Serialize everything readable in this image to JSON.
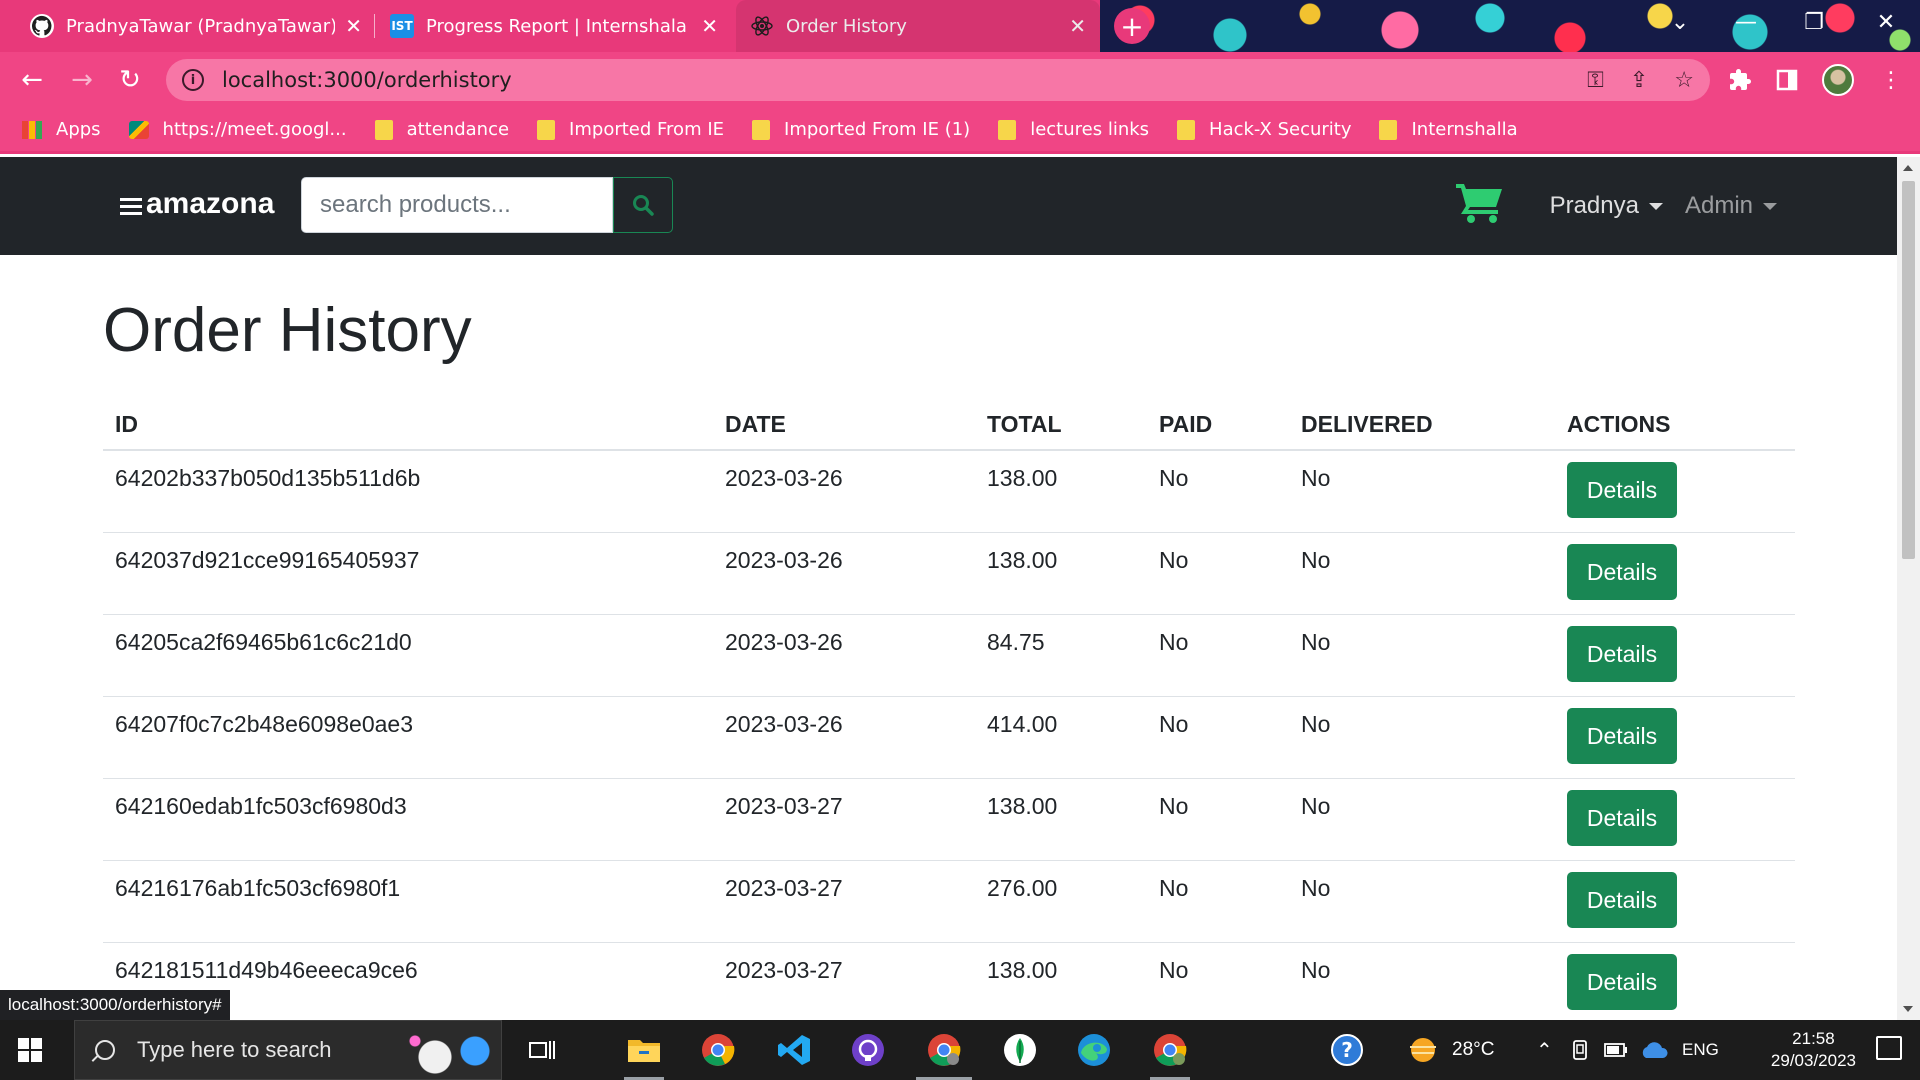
{
  "browser": {
    "tabs": [
      {
        "title": "PradnyaTawar (PradnyaTawar) / R",
        "favicon": "github-icon"
      },
      {
        "title": "Progress Report | Internshala Trai",
        "favicon": "internshala-icon",
        "favicon_text": "IST"
      },
      {
        "title": "Order History",
        "favicon": "react-icon",
        "active": true
      }
    ],
    "address": "localhost:3000/orderhistory",
    "bookmarks": [
      {
        "label": "Apps",
        "icon": "apps-grid-icon"
      },
      {
        "label": "https://meet.googl...",
        "icon": "meet-icon"
      },
      {
        "label": "attendance",
        "icon": "folder-icon"
      },
      {
        "label": "Imported From IE",
        "icon": "folder-icon"
      },
      {
        "label": "Imported From IE (1)",
        "icon": "folder-icon"
      },
      {
        "label": "lectures links",
        "icon": "folder-icon"
      },
      {
        "label": "Hack-X Security",
        "icon": "folder-icon"
      },
      {
        "label": "Internshalla",
        "icon": "folder-icon"
      }
    ],
    "status_url": "localhost:3000/orderhistory#",
    "theme_color": "#f04585"
  },
  "app": {
    "brand": "amazona",
    "search_placeholder": "search products...",
    "user_menu": "Pradnya",
    "admin_menu": "Admin",
    "accent": "#198754"
  },
  "page": {
    "title": "Order History",
    "columns": [
      "ID",
      "DATE",
      "TOTAL",
      "PAID",
      "DELIVERED",
      "ACTIONS"
    ],
    "details_label": "Details",
    "orders": [
      {
        "id": "64202b337b050d135b511d6b",
        "date": "2023-03-26",
        "total": "138.00",
        "paid": "No",
        "delivered": "No"
      },
      {
        "id": "642037d921cce99165405937",
        "date": "2023-03-26",
        "total": "138.00",
        "paid": "No",
        "delivered": "No"
      },
      {
        "id": "64205ca2f69465b61c6c21d0",
        "date": "2023-03-26",
        "total": "84.75",
        "paid": "No",
        "delivered": "No"
      },
      {
        "id": "64207f0c7c2b48e6098e0ae3",
        "date": "2023-03-26",
        "total": "414.00",
        "paid": "No",
        "delivered": "No"
      },
      {
        "id": "642160edab1fc503cf6980d3",
        "date": "2023-03-27",
        "total": "138.00",
        "paid": "No",
        "delivered": "No"
      },
      {
        "id": "64216176ab1fc503cf6980f1",
        "date": "2023-03-27",
        "total": "276.00",
        "paid": "No",
        "delivered": "No"
      },
      {
        "id": "642181511d49b46eeeca9ce6",
        "date": "2023-03-27",
        "total": "138.00",
        "paid": "No",
        "delivered": "No"
      }
    ]
  },
  "taskbar": {
    "search_placeholder": "Type here to search",
    "weather": "28°C",
    "language": "ENG",
    "time": "21:58",
    "date": "29/03/2023"
  }
}
